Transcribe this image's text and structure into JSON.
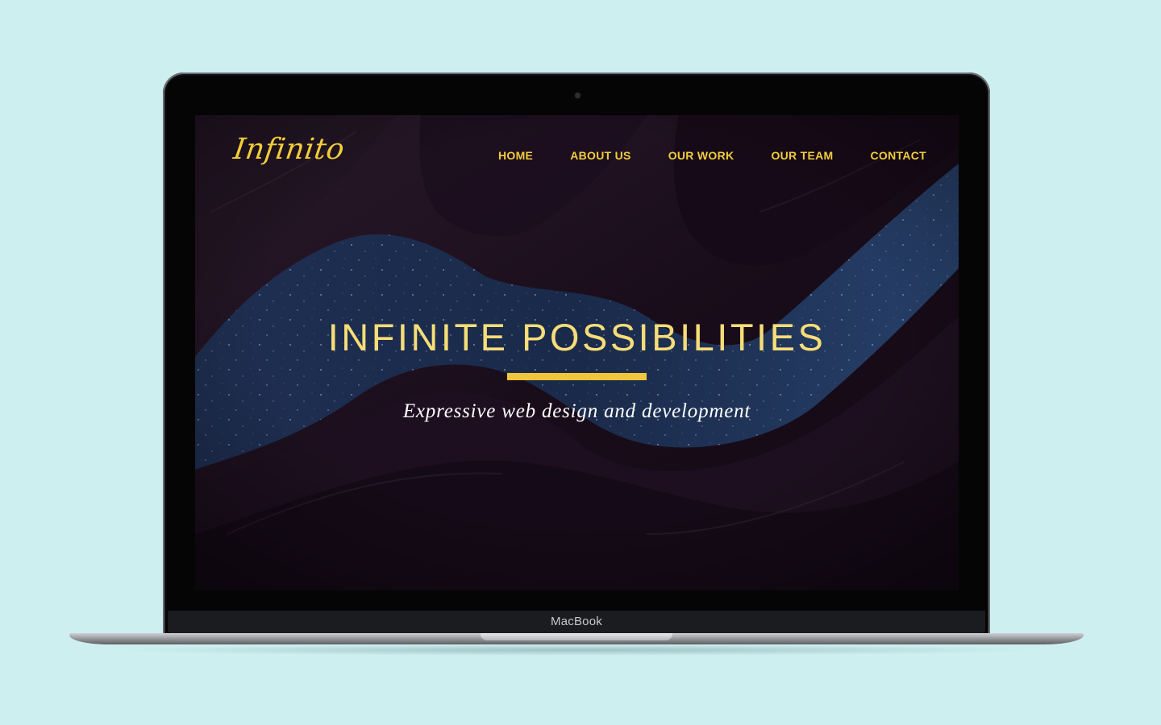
{
  "device": {
    "label": "MacBook"
  },
  "site": {
    "logo": "Infinito",
    "nav": [
      {
        "label": "HOME"
      },
      {
        "label": "ABOUT US"
      },
      {
        "label": "OUR WORK"
      },
      {
        "label": "OUR TEAM"
      },
      {
        "label": "CONTACT"
      }
    ],
    "hero": {
      "title": "INFINITE POSSIBILITIES",
      "subtitle": "Expressive web design and development"
    }
  },
  "colors": {
    "accent": "#f2cd3a",
    "screen_bg": "#1a0e1c",
    "backdrop": "#cdeff0"
  }
}
